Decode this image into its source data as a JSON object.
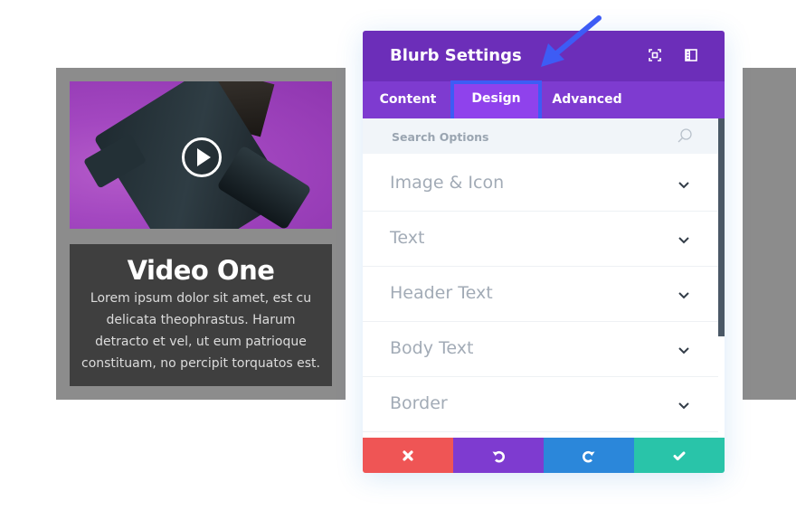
{
  "blurb": {
    "title": "Video One",
    "body": "Lorem ipsum dolor sit amet, est cu delicata theophrastus. Harum detracto et vel, ut eum patrioque constituam, no percipit torquatos est.",
    "media_icon": "play-icon"
  },
  "modal": {
    "title": "Blurb Settings",
    "header_icons": [
      "fullscreen-icon",
      "sidebar-layout-icon"
    ],
    "tabs": [
      {
        "label": "Content",
        "active": false
      },
      {
        "label": "Design",
        "active": true
      },
      {
        "label": "Advanced",
        "active": false
      }
    ],
    "search": {
      "placeholder": "Search Options",
      "value": ""
    },
    "groups": [
      {
        "label": "Image & Icon"
      },
      {
        "label": "Text"
      },
      {
        "label": "Header Text"
      },
      {
        "label": "Body Text"
      },
      {
        "label": "Border"
      }
    ],
    "footer": [
      {
        "action": "discard",
        "icon": "close-icon",
        "color": "#ef5555"
      },
      {
        "action": "undo",
        "icon": "undo-icon",
        "color": "#7e3bd0"
      },
      {
        "action": "redo",
        "icon": "redo-icon",
        "color": "#2b87da"
      },
      {
        "action": "save",
        "icon": "check-icon",
        "color": "#29c4a9"
      }
    ]
  },
  "colors": {
    "header": "#6c2eb9",
    "tabs": "#7e3bd0",
    "active_tab": "#8f42ec",
    "highlight": "#3d5cf5",
    "card_bg": "#8c8c8c",
    "caption_bg": "#3f3f3f"
  }
}
